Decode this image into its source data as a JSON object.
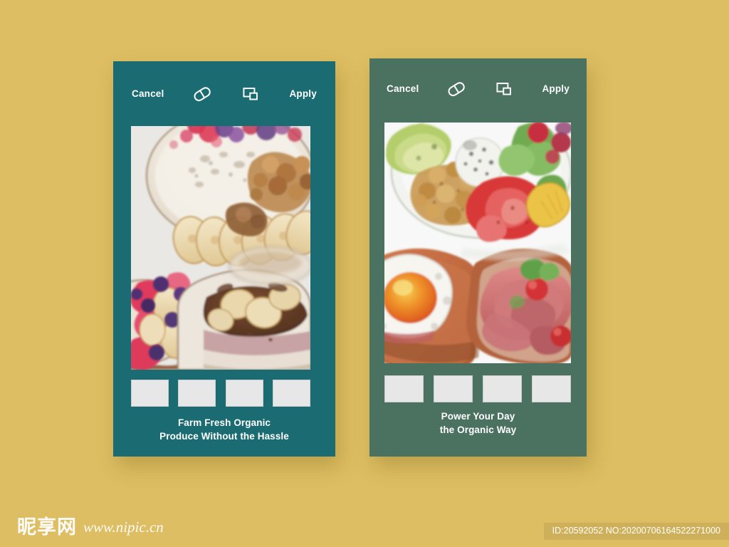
{
  "page": {
    "background_color": "#ddbe62",
    "watermark_cn": "昵享网",
    "watermark_url": "www.nipic.cn",
    "id_text": "ID:20592052 NO:20200706164522271000"
  },
  "cards": [
    {
      "id": "left",
      "theme_color": "#1b6b72",
      "topbar": {
        "cancel_label": "Cancel",
        "apply_label": "Apply",
        "icon_one": "capsule-icon",
        "icon_two": "layers-icon"
      },
      "photo": {
        "alt": "watercolor breakfast bowls with berries, banana slices and granola",
        "background": "#ffffff"
      },
      "thumbnails": [
        {
          "label": ""
        },
        {
          "label": ""
        },
        {
          "label": ""
        },
        {
          "label": ""
        }
      ],
      "caption": {
        "line1": "Farm Fresh Organic",
        "line2": "Produce Without the Hassle"
      }
    },
    {
      "id": "right",
      "theme_color": "#4b7261",
      "topbar": {
        "cancel_label": "Cancel",
        "apply_label": "Apply",
        "icon_one": "capsule-icon",
        "icon_two": "layers-icon"
      },
      "photo": {
        "alt": "watercolor salad bowl with avocado and chickpeas, fried egg toast and ham toast",
        "background": "#ffffff"
      },
      "thumbnails": [
        {
          "label": ""
        },
        {
          "label": ""
        },
        {
          "label": ""
        },
        {
          "label": ""
        }
      ],
      "caption": {
        "line1": "Power Your Day",
        "line2": "the Organic Way"
      }
    }
  ]
}
